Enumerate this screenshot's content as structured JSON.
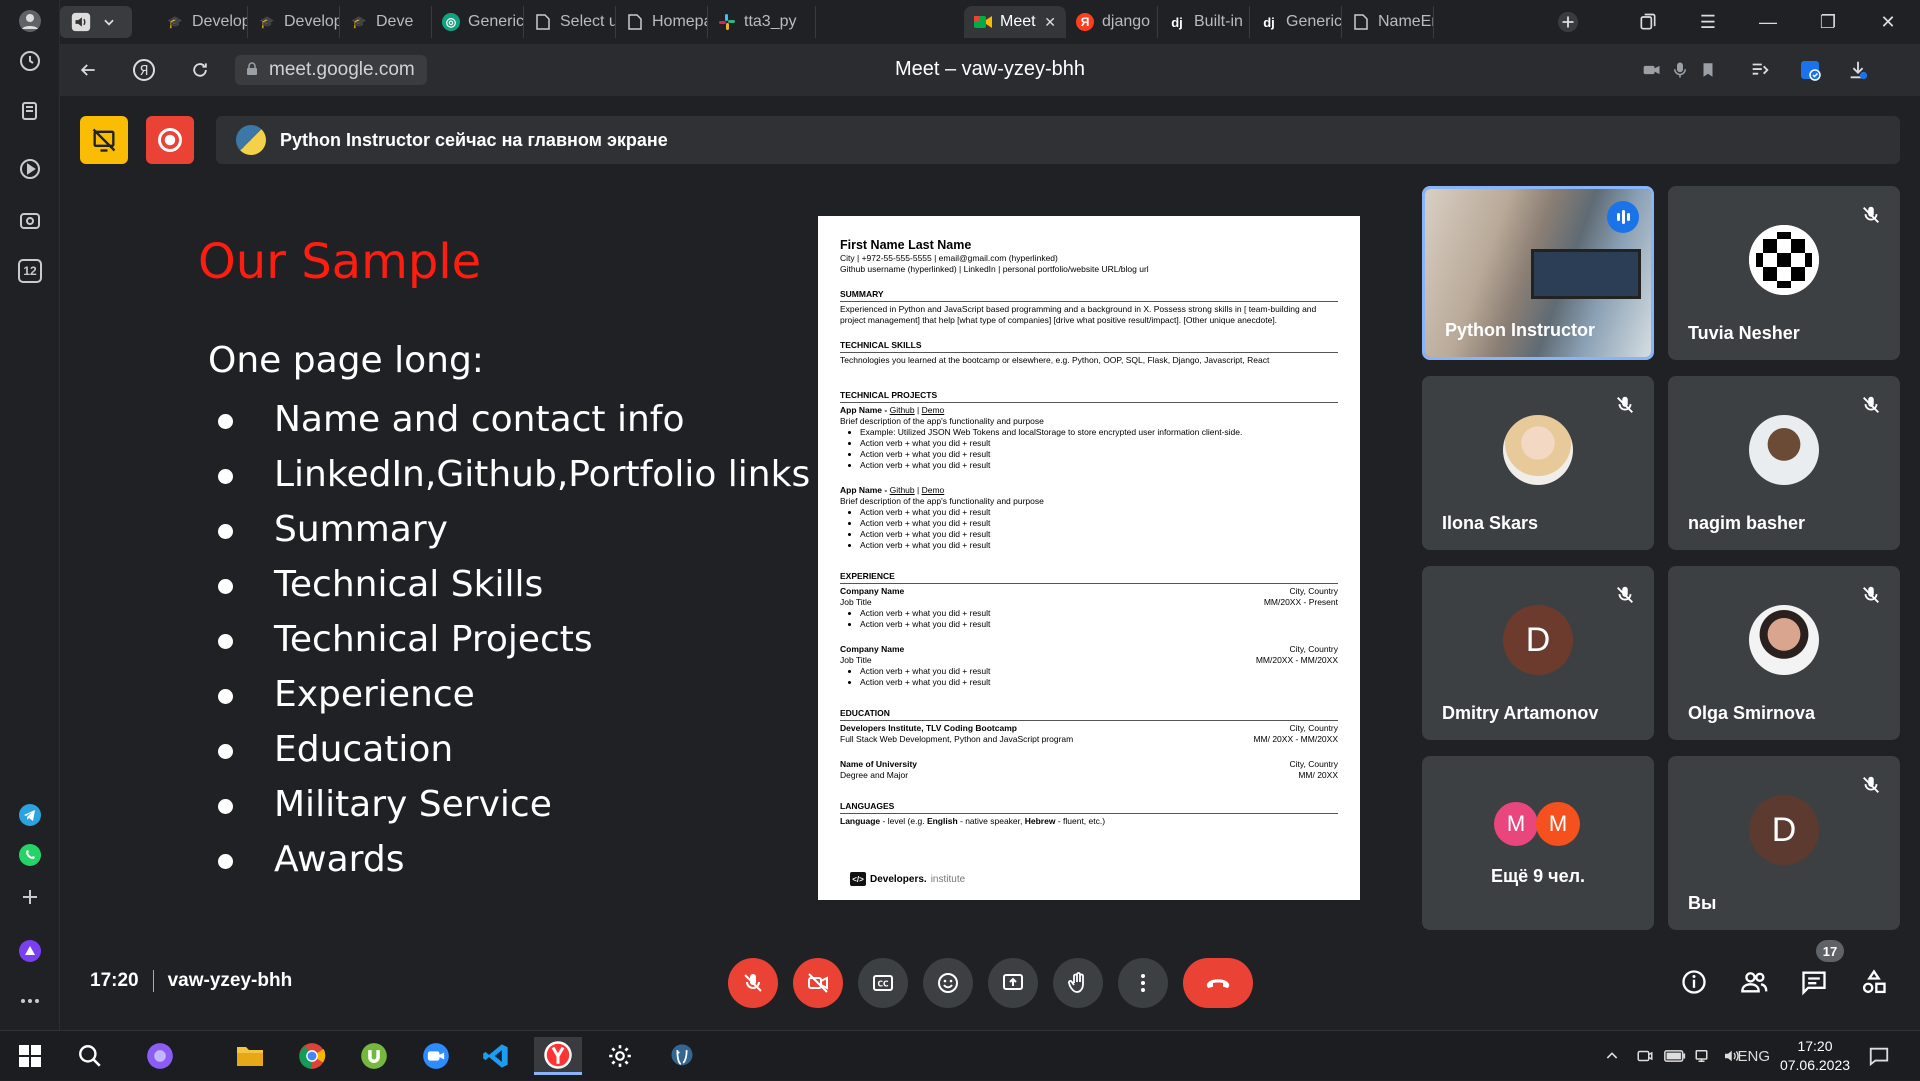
{
  "browser": {
    "tabs": [
      {
        "label": "Develop",
        "favicon": "graduation-cap"
      },
      {
        "label": "Develop",
        "favicon": "graduation-cap"
      },
      {
        "label": "Deve",
        "favicon": "graduation-cap"
      },
      {
        "label": "Generic",
        "favicon": "openai"
      },
      {
        "label": "Select u",
        "favicon": "document"
      },
      {
        "label": "Homepa",
        "favicon": "document"
      },
      {
        "label": "tta3_py",
        "favicon": "slack"
      },
      {
        "label": "Meet",
        "favicon": "google-meet",
        "active": true
      },
      {
        "label": "django",
        "favicon": "yandex"
      },
      {
        "label": "Built-in",
        "favicon": "django"
      },
      {
        "label": "Generic",
        "favicon": "django"
      },
      {
        "label": "NameEr",
        "favicon": "document"
      }
    ],
    "url": "meet.google.com",
    "page_title": "Meet – vaw-yzey-bhh",
    "sidebar_counter": "12"
  },
  "meet": {
    "presenting_banner": "Python Instructor сейчас на главном экране",
    "time": "17:20",
    "meeting_code": "vaw-yzey-bhh",
    "participants_count": "17",
    "colors": {
      "danger": "#ea4335",
      "accent": "#1a73e8",
      "tile": "#3c4043"
    }
  },
  "slide": {
    "title": "Our Sample",
    "subtitle": "One page long:",
    "bullets": [
      "Name and contact info",
      "LinkedIn,Github,Portfolio links",
      "Summary",
      "Technical Skills",
      "Technical Projects",
      "Experience",
      "Education",
      "Military Service",
      "Awards"
    ]
  },
  "resume": {
    "name": "First Name Last Name",
    "contact": "City | +972-55-555-5555 | email@gmail.com (hyperlinked)",
    "links": "Github username (hyperlinked) | LinkedIn | personal portfolio/website URL/blog url",
    "summary_h": "SUMMARY",
    "summary": "Experienced in Python and JavaScript based programming and a background in X. Possess strong skills in [ team-building and project management] that help [what type of companies] [drive what positive result/impact]. [Other unique anecdote].",
    "skills_h": "TECHNICAL SKILLS",
    "skills": "Technologies you learned at the bootcamp or elsewhere, e.g. Python, OOP, SQL, Flask, Django, Javascript, React",
    "projects_h": "TECHNICAL PROJECTS",
    "app_name": "App Name - ",
    "github": "Github",
    "pipe": " | ",
    "demo": "Demo",
    "app_desc": "Brief description of the app's functionality and purpose",
    "example": "Example: Utilized JSON Web Tokens and localStorage to store encrypted user information client-side.",
    "action": "Action verb + what you did +  result",
    "experience_h": "EXPERIENCE",
    "company": "Company Name",
    "city": "City, Country",
    "job": "Job Title",
    "date1": "MM/20XX - Present",
    "date2": "MM/20XX - MM/20XX",
    "education_h": "EDUCATION",
    "edu1": "Developers Institute, TLV Coding Bootcamp",
    "edu1_desc": "Full Stack Web Development, Python and JavaScript program",
    "edu1_date": "MM/ 20XX - MM/20XX",
    "edu2": "Name of University",
    "edu2_desc": "Degree and Major",
    "edu2_date": "MM/ 20XX",
    "languages_h": "LANGUAGES",
    "lang_pre": "Language",
    "lang_mid1": " - level (e.g. ",
    "lang_eng": "English",
    "lang_mid2": " - native speaker, ",
    "lang_heb": "Hebrew",
    "lang_end": " - fluent, etc.)",
    "logo": "Developers.",
    "logo_sub": "institute"
  },
  "participants": [
    {
      "name": "Python Instructor",
      "speaking": true
    },
    {
      "name": "Tuvia Nesher"
    },
    {
      "name": "Ilona Skars"
    },
    {
      "name": "nagim basher"
    },
    {
      "name": "Dmitry Artamonov",
      "initial": "D",
      "color": "#6d3b2e"
    },
    {
      "name": "Olga Smirnova"
    },
    {
      "name": "Ещё 9 чел.",
      "initials": [
        "M",
        "M"
      ]
    },
    {
      "name": "Вы",
      "initial": "D",
      "color": "#5d3a2f"
    }
  ],
  "taskbar": {
    "lang": "ENG",
    "time": "17:20",
    "date": "07.06.2023"
  }
}
